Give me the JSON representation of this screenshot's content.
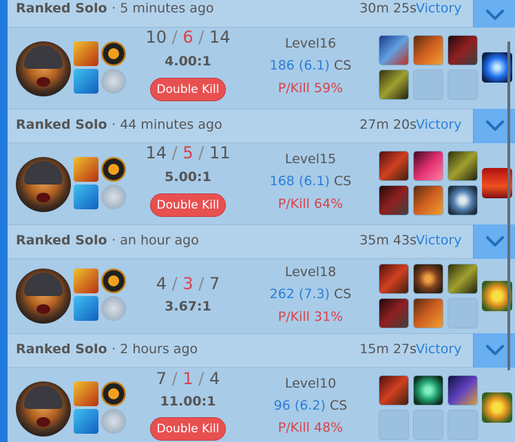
{
  "matches": [
    {
      "queue": "Ranked Solo",
      "time_ago": "· 5 minutes ago",
      "duration": "30m 25s",
      "result": "Victory",
      "kills": "10",
      "deaths": "6",
      "assists": "14",
      "kda_ratio": "4.00:1",
      "multikill": "Double Kill",
      "level": "Level16",
      "cs": "186 (6.1)",
      "cs_label": "CS",
      "pkill": "P/Kill 59%",
      "items": [
        "blue-sword",
        "red-gauntlet",
        "dark-blade",
        "green-boots",
        "",
        ""
      ],
      "trinket": "blue-orb"
    },
    {
      "queue": "Ranked Solo",
      "time_ago": "· 44 minutes ago",
      "duration": "27m 20s",
      "result": "Victory",
      "kills": "14",
      "deaths": "5",
      "assists": "11",
      "kda_ratio": "5.00:1",
      "multikill": "Double Kill",
      "level": "Level15",
      "cs": "168 (6.1)",
      "cs_label": "CS",
      "pkill": "P/Kill 64%",
      "items": [
        "red-hammer",
        "pink-crystal",
        "green-boots",
        "dark-blade",
        "red-gauntlet",
        "silver-shield"
      ],
      "trinket": "red-lens"
    },
    {
      "queue": "Ranked Solo",
      "time_ago": "· an hour ago",
      "duration": "35m 43s",
      "result": "Victory",
      "kills": "4",
      "deaths": "3",
      "assists": "7",
      "kda_ratio": "3.67:1",
      "multikill": "",
      "level": "Level18",
      "cs": "262 (7.3)",
      "cs_label": "CS",
      "pkill": "P/Kill 31%",
      "items": [
        "red-hammer",
        "bronze-helm",
        "green-boots",
        "dark-blade",
        "red-gauntlet",
        ""
      ],
      "trinket": "yellow-flower"
    },
    {
      "queue": "Ranked Solo",
      "time_ago": "· 2 hours ago",
      "duration": "15m 27s",
      "result": "Victory",
      "kills": "7",
      "deaths": "1",
      "assists": "4",
      "kda_ratio": "11.00:1",
      "multikill": "Double Kill",
      "level": "Level10",
      "cs": "96 (6.2)",
      "cs_label": "CS",
      "pkill": "P/Kill 48%",
      "items": [
        "red-hammer",
        "green-potion",
        "purple-boots",
        "",
        "",
        ""
      ],
      "trinket": "yellow-flower"
    }
  ],
  "icons": {
    "expand": "chevron-down-icon",
    "spell_1": "ignite-icon",
    "spell_2": "flash-icon",
    "rune_1": "precision-rune-icon",
    "rune_2": "secondary-rune-icon"
  },
  "colors": {
    "accent": "#1f7bdb",
    "victory": "#2a7fd6",
    "deaths": "#d9434a",
    "multikill": "#e85050",
    "panel": "#a8cbe8"
  }
}
